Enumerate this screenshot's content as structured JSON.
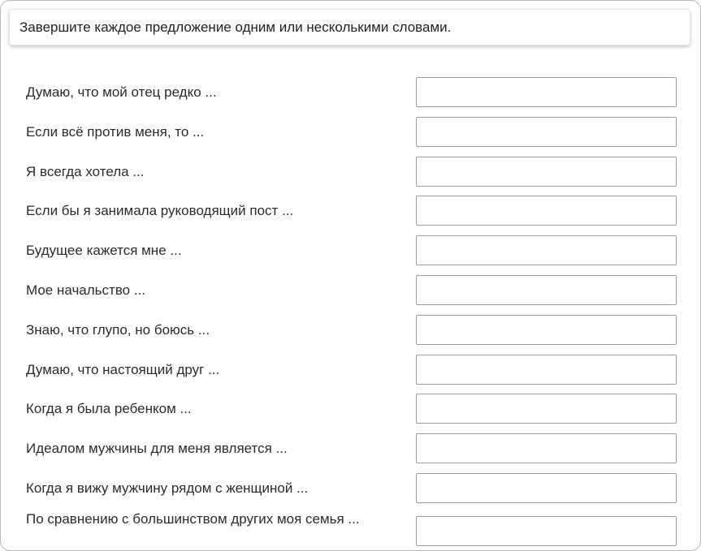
{
  "instruction": "Завершите каждое предложение одним или несколькими словами.",
  "items": [
    {
      "label": "Думаю, что мой отец редко ...",
      "value": ""
    },
    {
      "label": "Если всё против меня, то ...",
      "value": ""
    },
    {
      "label": "Я всегда хотела ...",
      "value": ""
    },
    {
      "label": "Если бы я занимала руководящий пост ...",
      "value": ""
    },
    {
      "label": "Будущее кажется мне ...",
      "value": ""
    },
    {
      "label": "Мое начальство ...",
      "value": ""
    },
    {
      "label": "Знаю, что глупо, но боюсь ...",
      "value": ""
    },
    {
      "label": "Думаю, что настоящий друг ...",
      "value": ""
    },
    {
      "label": "Когда я была ребенком ...",
      "value": ""
    },
    {
      "label": "Идеалом мужчины для меня является ...",
      "value": ""
    },
    {
      "label": "Когда я вижу мужчину рядом с женщиной ...",
      "value": ""
    },
    {
      "label": "По сравнению с большинством других моя семья ...",
      "value": ""
    }
  ]
}
